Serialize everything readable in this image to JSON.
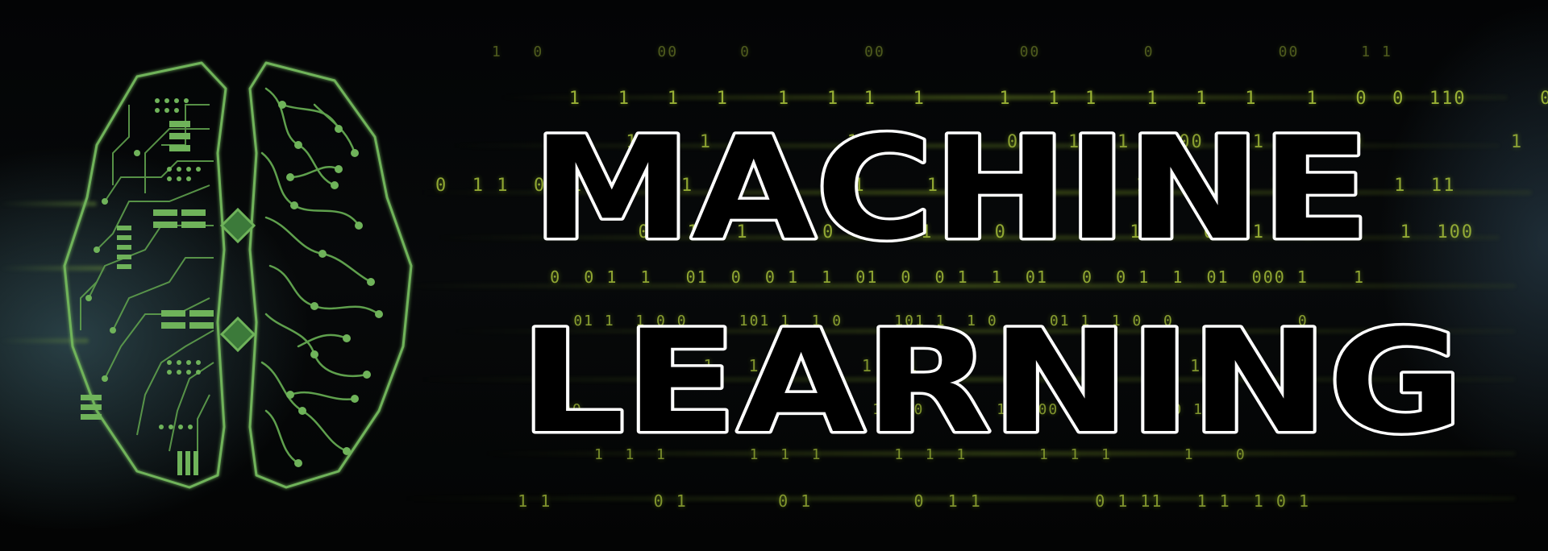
{
  "banner": {
    "title_line1": "MACHINE",
    "title_line2": "LEARNING"
  },
  "binary_rows": [
    "1   0           00      0           00             00          0            00      1 1",
    "   1   1   1   1    1   1  1   1      1   1  1    1   1   1    1   0  0  110      0    0",
    "     1     1   00      1    1   00  0    1   1   000    1   00  0            1  10  0",
    "0  1 1  0  1   1    1   1   1     1     1   1   1     1  1   1   1  1   1     1  11",
    "      0   1   1      0   1   1     0   1   1  1     0   1   1       1  100",
    "   0  0 1  1   01  0  0 1  1  01  0  0 1  1  01   0  0 1  1  01  000 1    1",
    "    01 1  1 0 0     101 1  1 0     101 1  1 0     01 1  1 0  0            0",
    "        1   1         1   1        1   1       1   1       1    1 1",
    "   1 100       10       100         1 100       1 1 00           0 1",
    "      1  1  1        1  1  1       1  1  1       1  1  1       1    0",
    "   1 1         0 1        0 1         0  1 1          0 1 11   1 1  1 0 1"
  ],
  "colors": {
    "digits": "#a8c23a",
    "brain_green": "#6fb35a",
    "title_stroke": "#ffffff",
    "background": "#050607"
  },
  "icons": {
    "brain": "circuit-brain-icon"
  }
}
